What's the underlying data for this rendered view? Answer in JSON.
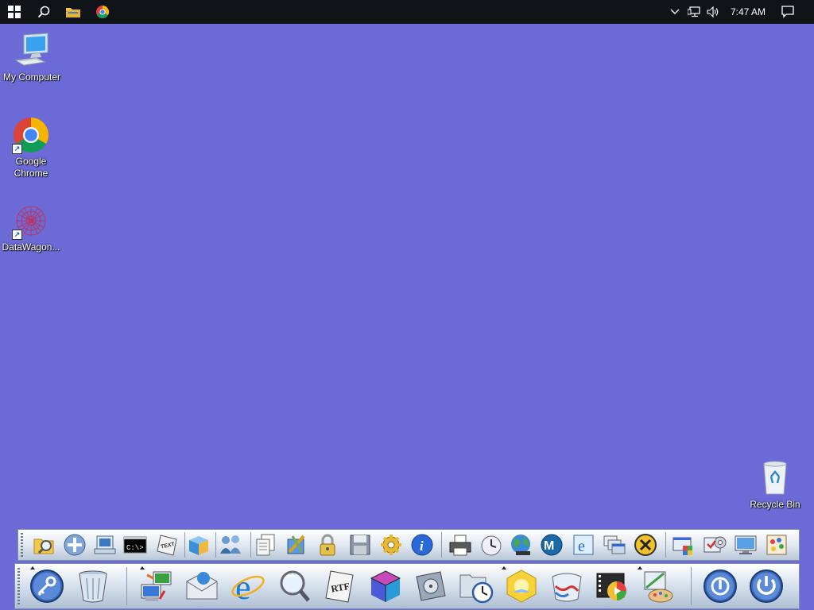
{
  "taskbar": {
    "clock": "7:47 AM",
    "start_icon": "windows-start-icon",
    "search_icon": "search-icon",
    "explorer_icon": "file-explorer-icon",
    "chrome_icon": "chrome-icon"
  },
  "desktop": {
    "background": "#6b6ad6",
    "icons": [
      {
        "label": "My Computer",
        "icon": "computer-icon"
      },
      {
        "label": "Google Chrome",
        "icon": "chrome-icon"
      },
      {
        "label": "DataWagon...",
        "icon": "datawagon-icon"
      },
      {
        "label": "Recycle Bin",
        "icon": "recycle-bin-icon"
      }
    ]
  },
  "dock_top_icons": [
    "search-folder-icon",
    "add-icon",
    "network-icon",
    "command-prompt-icon",
    "text-file-icon",
    "box-icon",
    "users-icon",
    "documents-icon",
    "tools-icon",
    "lock-icon",
    "save-icon",
    "settings-icon",
    "info-icon",
    "printer-icon",
    "clock-icon",
    "globe-icon",
    "m-app-icon",
    "ie-doc-icon",
    "windows-icon",
    "close-icon",
    "folder-apps-icon",
    "task-settings-icon",
    "monitor-icon",
    "paint-icon"
  ],
  "dock_bottom_icons": [
    "key-icon",
    "trash-icon",
    "computer-transfer-icon",
    "mail-icon",
    "internet-explorer-icon",
    "magnifier-icon",
    "rtf-document-icon",
    "cube-icon",
    "disk-icon",
    "folder-clock-icon",
    "sun-icon",
    "media-icon",
    "video-icon",
    "paint-easel-icon",
    "shutdown-icon",
    "power-icon"
  ]
}
